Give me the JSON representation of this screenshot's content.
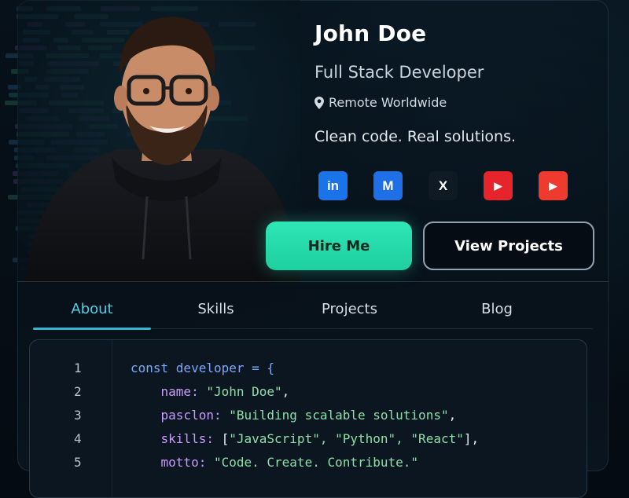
{
  "profile": {
    "name": "John Doe",
    "role": "Full Stack Developer",
    "location": "Remote Worldwide",
    "tagline": "Clean code. Real solutions."
  },
  "socials": [
    {
      "id": "linkedin",
      "glyph": "in",
      "icon": "linkedin-icon",
      "color": "#1a73e8"
    },
    {
      "id": "dev",
      "glyph": "M",
      "icon": "dev-icon",
      "color": "#1f6fe6"
    },
    {
      "id": "x",
      "glyph": "X",
      "icon": "x-icon",
      "color": "#0f1a24"
    },
    {
      "id": "youtube-1",
      "glyph": "▶",
      "icon": "youtube-icon",
      "color": "#e5242c"
    },
    {
      "id": "youtube-2",
      "glyph": "▶",
      "icon": "youtube-icon",
      "color": "#ee3a2f"
    }
  ],
  "actions": {
    "hire": "Hire Me",
    "projects": "View Projects"
  },
  "tabs": [
    {
      "label": "About",
      "active": true
    },
    {
      "label": "Skills",
      "active": false
    },
    {
      "label": "Projects",
      "active": false
    },
    {
      "label": "Blog",
      "active": false
    }
  ],
  "code": {
    "line_numbers": [
      "1",
      "2",
      "3",
      "4",
      "5"
    ],
    "lines": [
      [
        {
          "t": "const developer = {",
          "c": "kw"
        }
      ],
      [
        {
          "t": "    name: ",
          "c": "prop"
        },
        {
          "t": "\"John Doe\"",
          "c": "str"
        },
        {
          "t": ",",
          "c": "punct"
        }
      ],
      [
        {
          "t": "    pasclon: ",
          "c": "prop"
        },
        {
          "t": "\"Building scalable solutions\"",
          "c": "str"
        },
        {
          "t": ",",
          "c": "punct"
        }
      ],
      [
        {
          "t": "    skills: ",
          "c": "prop"
        },
        {
          "t": "[",
          "c": "punct"
        },
        {
          "t": "\"JavaScript\", \"Python\", \"React\"",
          "c": "str"
        },
        {
          "t": "],",
          "c": "punct"
        }
      ],
      [
        {
          "t": "    motto: ",
          "c": "prop"
        },
        {
          "t": "\"Code. Create. Contribute.\"",
          "c": "str"
        }
      ]
    ]
  },
  "colors": {
    "accent": "#2ee6b6",
    "tab_active": "#4fd1e6",
    "background": "#050b12"
  }
}
